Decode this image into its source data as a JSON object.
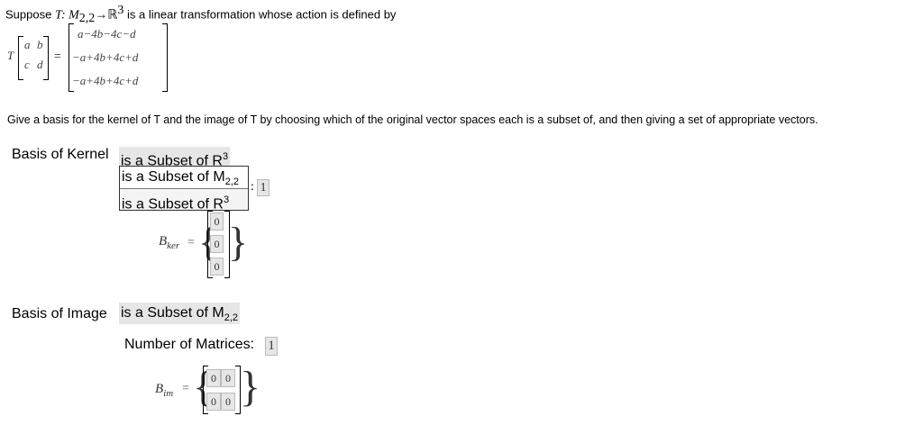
{
  "problem": {
    "prefix": "Suppose ",
    "map": "T: M",
    "domain_sub": "2,2",
    "arrow": "→ℝ",
    "codomain_sup": "3",
    "suffix": " is a linear transformation whose action is defined by"
  },
  "definition": {
    "T": "T",
    "input": [
      [
        "a",
        "b"
      ],
      [
        "c",
        "d"
      ]
    ],
    "equals": "=",
    "output": [
      "a−4b−4c−d",
      "−a+4b+4c+d",
      "−a+4b+4c+d"
    ]
  },
  "instructions": "Give a basis for the kernel of T and the image of T by choosing which of the original vector spaces each is a subset of, and then giving a set of appropriate vectors.",
  "kernel": {
    "label": "Basis of Kernel",
    "selected": "is a Subset of R",
    "selected_sup": "3",
    "options": [
      {
        "text": "is a Subset of M",
        "sub": "2,2",
        "sup": ""
      },
      {
        "text": "is a Subset of R",
        "sub": "",
        "sup": "3"
      }
    ],
    "count_prefix": ":",
    "count_value": "1",
    "basis_label": "B",
    "basis_sub": "ker",
    "equals": "=",
    "vector": [
      "0",
      "0",
      "0"
    ]
  },
  "image": {
    "label": "Basis of Image",
    "selected": "is a Subset of M",
    "selected_sub": "2,2",
    "count_label": "Number of Matrices:",
    "count_value": "1",
    "basis_label": "B",
    "basis_sub": "im",
    "equals": "=",
    "matrix": [
      [
        "0",
        "0"
      ],
      [
        "0",
        "0"
      ]
    ]
  }
}
